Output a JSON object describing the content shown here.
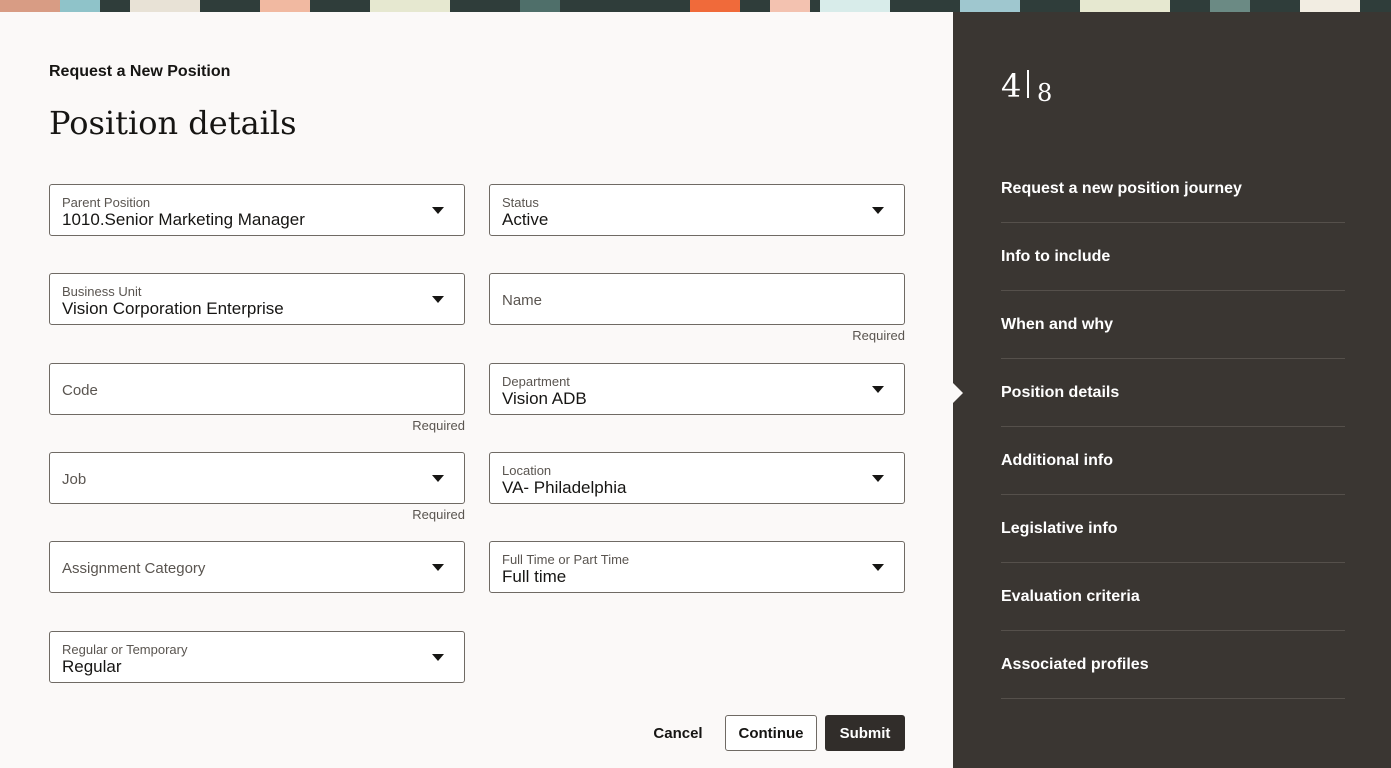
{
  "header": {
    "eyebrow": "Request a New Position",
    "title": "Position details"
  },
  "form": {
    "parent_position": {
      "label": "Parent Position",
      "value": "1010.Senior Marketing Manager"
    },
    "status": {
      "label": "Status",
      "value": "Active"
    },
    "business_unit": {
      "label": "Business Unit",
      "value": "Vision Corporation Enterprise"
    },
    "name": {
      "label": "Name",
      "helper": "Required"
    },
    "code": {
      "label": "Code",
      "helper": "Required"
    },
    "department": {
      "label": "Department",
      "value": "Vision ADB"
    },
    "job": {
      "label": "Job",
      "helper": "Required"
    },
    "location": {
      "label": "Location",
      "value": "VA- Philadelphia"
    },
    "assignment_category": {
      "label": "Assignment Category"
    },
    "full_or_part_time": {
      "label": "Full Time or Part Time",
      "value": "Full time"
    },
    "regular_or_temporary": {
      "label": "Regular or Temporary",
      "value": "Regular"
    }
  },
  "actions": {
    "cancel": "Cancel",
    "continue": "Continue",
    "submit": "Submit"
  },
  "progress": {
    "current": "4",
    "total": "8"
  },
  "steps": [
    {
      "label": "Request a new position journey"
    },
    {
      "label": "Info to include"
    },
    {
      "label": "When and why"
    },
    {
      "label": "Position details",
      "current": true
    },
    {
      "label": "Additional info"
    },
    {
      "label": "Legislative info"
    },
    {
      "label": "Evaluation criteria"
    },
    {
      "label": "Associated profiles"
    }
  ],
  "icons": {
    "dropdown": "chevron-down-icon",
    "current_step": "current-step-pointer-icon"
  },
  "colors": {
    "sidebar_bg": "#3a3632",
    "page_bg": "#fbf9f8",
    "primary_button": "#312d2a"
  }
}
